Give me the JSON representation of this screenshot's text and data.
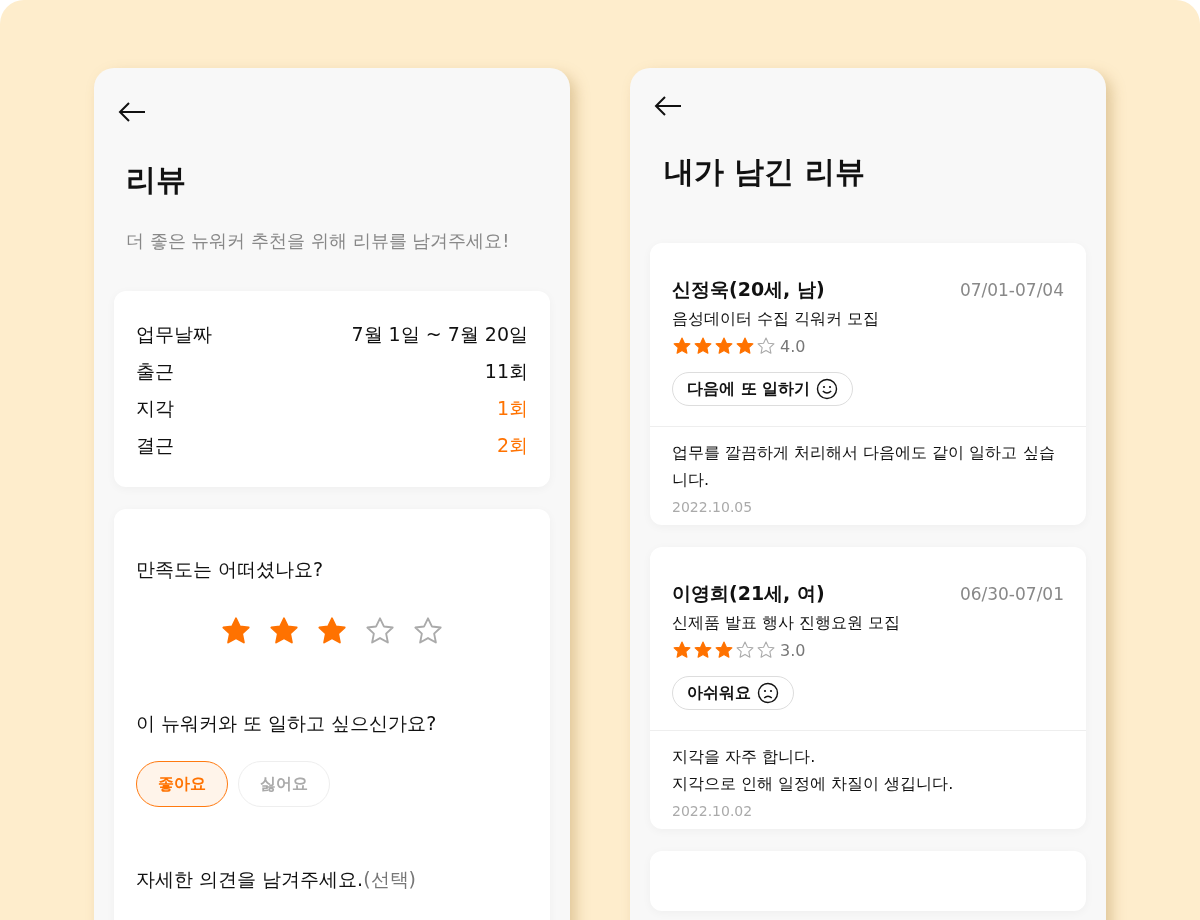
{
  "review_form": {
    "title": "리뷰",
    "subtitle": "더 좋은 뉴워커 추천을 위해 리뷰를 남겨주세요!",
    "stats": [
      {
        "label": "업무날짜",
        "value": "7월 1일 ~ 7월 20일",
        "highlight": false
      },
      {
        "label": "출근",
        "value": "11회",
        "highlight": false
      },
      {
        "label": "지각",
        "value": "1회",
        "highlight": true
      },
      {
        "label": "결근",
        "value": "2회",
        "highlight": true
      }
    ],
    "satisfaction": {
      "question": "만족도는 어떠셨나요?",
      "stars": 3
    },
    "rehire": {
      "question": "이 뉴워커와 또 일하고 싶으신가요?",
      "options": [
        {
          "label": "좋아요",
          "selected": true
        },
        {
          "label": "싫어요",
          "selected": false
        }
      ]
    },
    "comment": {
      "label": "자세한 의견을 남겨주세요.",
      "note": "(선택)"
    }
  },
  "my_reviews": {
    "title": "내가 남긴 리뷰",
    "reviews": [
      {
        "name": "신정욱(20세, 남)",
        "period": "07/01-07/04",
        "job": "음성데이터 수집 긱워커 모집",
        "stars": 4,
        "score": "4.0",
        "verdict": {
          "label": "다음에 또 일하기",
          "kind": "happy"
        },
        "comment": "업무를 깔끔하게 처리해서 다음에도 같이 일하고 싶습니다.",
        "date": "2022.10.05"
      },
      {
        "name": "이영희(21세, 여)",
        "period": "06/30-07/01",
        "job": "신제품 발표 행사 진행요원 모집",
        "stars": 3,
        "score": "3.0",
        "verdict": {
          "label": "아쉬워요",
          "kind": "sad"
        },
        "comment": "지각을 자주 합니다.\n지각으로 인해 일정에 차질이 생깁니다.",
        "date": "2022.10.02"
      }
    ]
  }
}
